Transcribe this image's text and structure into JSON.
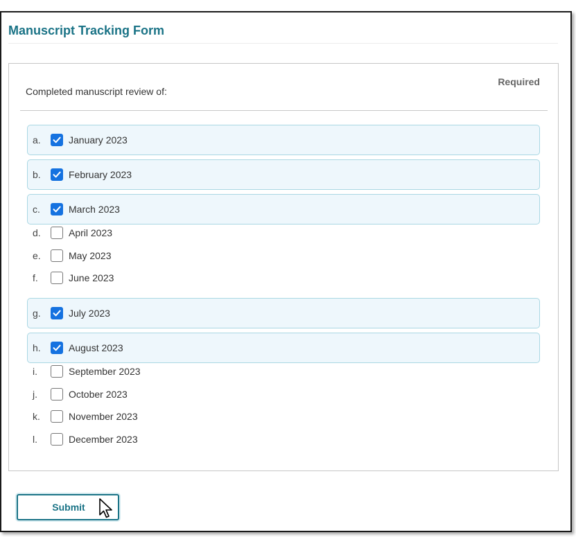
{
  "form": {
    "title": "Manuscript Tracking Form",
    "question": "Completed manuscript review of:",
    "required_label": "Required",
    "options": [
      {
        "letter": "a.",
        "label": "January 2023",
        "checked": true
      },
      {
        "letter": "b.",
        "label": "February 2023",
        "checked": true
      },
      {
        "letter": "c.",
        "label": "March 2023",
        "checked": true
      },
      {
        "letter": "d.",
        "label": "April 2023",
        "checked": false
      },
      {
        "letter": "e.",
        "label": "May 2023",
        "checked": false
      },
      {
        "letter": "f.",
        "label": "June 2023",
        "checked": false
      },
      {
        "letter": "g.",
        "label": "July 2023",
        "checked": true
      },
      {
        "letter": "h.",
        "label": "August 2023",
        "checked": true
      },
      {
        "letter": "i.",
        "label": "September 2023",
        "checked": false
      },
      {
        "letter": "j.",
        "label": "October 2023",
        "checked": false
      },
      {
        "letter": "k.",
        "label": "November 2023",
        "checked": false
      },
      {
        "letter": "l.",
        "label": "December 2023",
        "checked": false
      }
    ],
    "submit_label": "Submit"
  },
  "colors": {
    "title": "#1a7386",
    "checkbox_checked": "#1572e0",
    "selected_row_bg": "#eef7fc",
    "selected_row_border": "#a9d7e3"
  },
  "icons": {
    "checkbox": "check-icon",
    "pointer": "mouse-pointer-icon"
  }
}
